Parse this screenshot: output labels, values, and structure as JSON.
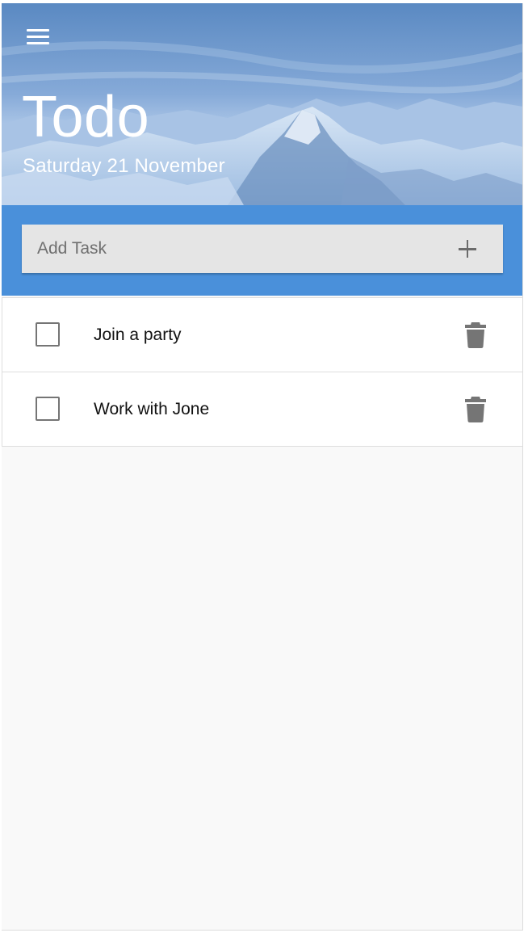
{
  "header": {
    "title": "Todo",
    "date": "Saturday 21 November",
    "menu_icon": "hamburger-menu-icon"
  },
  "add_task": {
    "placeholder": "Add Task",
    "value": "",
    "button_icon": "plus-icon"
  },
  "tasks": [
    {
      "text": "Join a party",
      "completed": false
    },
    {
      "text": "Work with Jone",
      "completed": false
    }
  ],
  "colors": {
    "accent": "#4a90da",
    "input_bg": "#e5e5e5",
    "icon_gray": "#757575",
    "page_bg": "#f9f9f9"
  }
}
